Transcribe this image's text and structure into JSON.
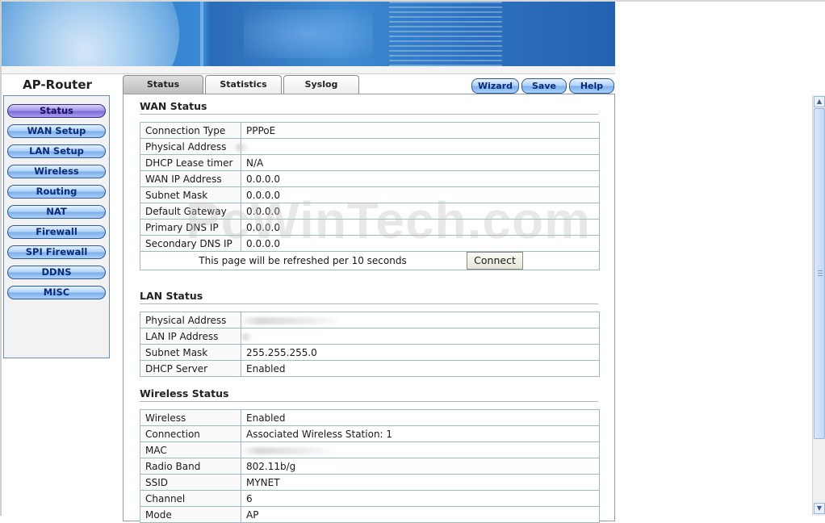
{
  "brand": "AP-Router",
  "nav": [
    {
      "label": "Status",
      "active": true
    },
    {
      "label": "WAN Setup",
      "active": false
    },
    {
      "label": "LAN Setup",
      "active": false
    },
    {
      "label": "Wireless",
      "active": false
    },
    {
      "label": "Routing",
      "active": false
    },
    {
      "label": "NAT",
      "active": false
    },
    {
      "label": "Firewall",
      "active": false
    },
    {
      "label": "SPI Firewall",
      "active": false
    },
    {
      "label": "DDNS",
      "active": false
    },
    {
      "label": "MISC",
      "active": false
    }
  ],
  "tabs": [
    {
      "label": "Status",
      "active": true
    },
    {
      "label": "Statistics",
      "active": false
    },
    {
      "label": "Syslog",
      "active": false
    }
  ],
  "toolbar": {
    "wizard": "Wizard",
    "save": "Save",
    "help": "Help"
  },
  "wan": {
    "title": "WAN Status",
    "rows": [
      {
        "label": "Connection Type",
        "value": "PPPoE"
      },
      {
        "label": "Physical Address",
        "value": ""
      },
      {
        "label": "DHCP Lease timer",
        "value": "N/A"
      },
      {
        "label": "WAN IP Address",
        "value": "0.0.0.0"
      },
      {
        "label": "Subnet Mask",
        "value": "0.0.0.0"
      },
      {
        "label": "Default Gateway",
        "value": "0.0.0.0"
      },
      {
        "label": "Primary DNS IP",
        "value": "0.0.0.0"
      },
      {
        "label": "Secondary DNS IP",
        "value": "0.0.0.0"
      }
    ],
    "refresh_text": "This page will be refreshed per 10 seconds",
    "connect_label": "Connect"
  },
  "lan": {
    "title": "LAN Status",
    "rows": [
      {
        "label": "Physical Address",
        "value": ""
      },
      {
        "label": "LAN IP Address",
        "value": ""
      },
      {
        "label": "Subnet Mask",
        "value": "255.255.255.0"
      },
      {
        "label": "DHCP Server",
        "value": "Enabled"
      }
    ]
  },
  "wireless": {
    "title": "Wireless Status",
    "rows": [
      {
        "label": "Wireless",
        "value": "Enabled"
      },
      {
        "label": "Connection",
        "value": "Associated Wireless Station: 1"
      },
      {
        "label": "MAC",
        "value": ""
      },
      {
        "label": "Radio Band",
        "value": "802.11b/g"
      },
      {
        "label": "SSID",
        "value": "MYNET"
      },
      {
        "label": "Channel",
        "value": "6"
      },
      {
        "label": "Mode",
        "value": "AP"
      }
    ]
  },
  "watermark": "PcWinTech.com",
  "colors": {
    "nav_button": "#a9d0fa",
    "nav_active": "#7e6ed8",
    "panel_border": "#9a9a9a",
    "table_border": "#9dbcc0"
  }
}
